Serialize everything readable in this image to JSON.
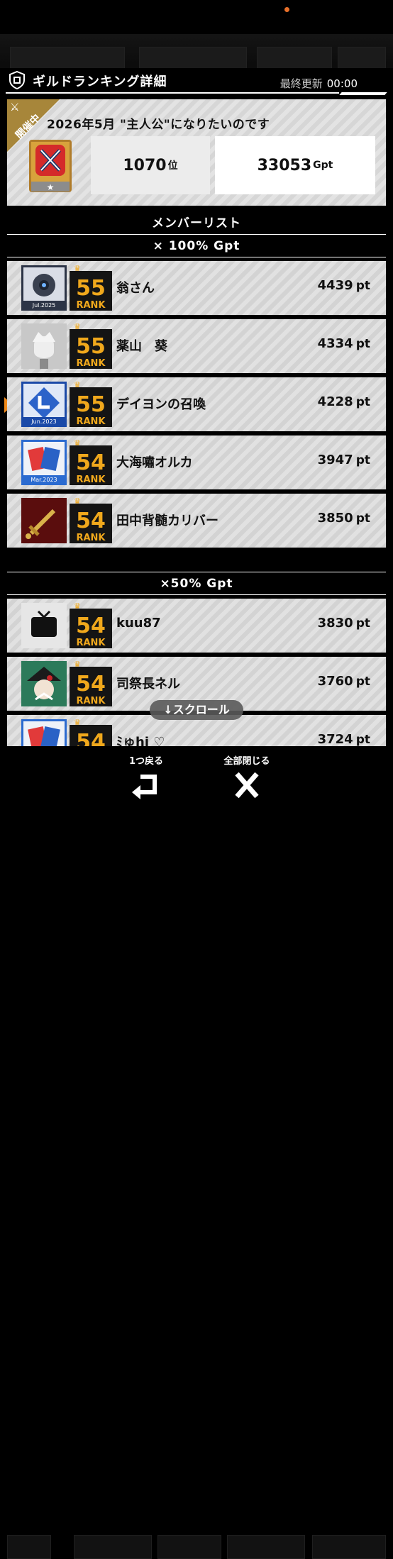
{
  "header": {
    "title": "ギルドランキング詳細",
    "updated_label": "最終更新",
    "updated_time": "00:00"
  },
  "event": {
    "status": "開催中",
    "title": "2026年5月 \"主人公\"になりたいのです",
    "rank": "1070",
    "rank_unit": "位",
    "gpt": "33053",
    "gpt_unit": "Gpt"
  },
  "member_list_label": "メンバーリスト",
  "sections": [
    {
      "label": "× 100% Gpt"
    },
    {
      "label": "×50% Gpt"
    }
  ],
  "members": [
    {
      "name": "翁さん",
      "points": "4439",
      "rank": "55",
      "unit": "pt"
    },
    {
      "name": "薬山　葵",
      "points": "4334",
      "rank": "55",
      "unit": "pt"
    },
    {
      "name": "デイヨンの召喚",
      "points": "4228",
      "rank": "55",
      "unit": "pt"
    },
    {
      "name": "大海嘯オルカ",
      "points": "3947",
      "rank": "54",
      "unit": "pt"
    },
    {
      "name": "田中背髄カリバー",
      "points": "3850",
      "rank": "54",
      "unit": "pt"
    },
    {
      "name": "kuu87",
      "points": "3830",
      "rank": "54",
      "unit": "pt"
    },
    {
      "name": "司祭長ネル",
      "points": "3760",
      "rank": "54",
      "unit": "pt"
    },
    {
      "name": "ﾐゅhj ♡",
      "points": "3724",
      "rank": "54",
      "unit": "pt"
    }
  ],
  "rank_badge_label": "RANK",
  "avatar_dates": [
    "Jul.2025",
    "Jun.2023",
    "Mar.2023"
  ],
  "scroll_hint": "↓スクロール",
  "controls": {
    "back_label": "1つ戻る",
    "close_all_label": "全部閉じる"
  },
  "accent_colors": {
    "ribbon": "#a7863a",
    "pointer": "#f08a1a",
    "rank_gold": "#f0a81c"
  }
}
